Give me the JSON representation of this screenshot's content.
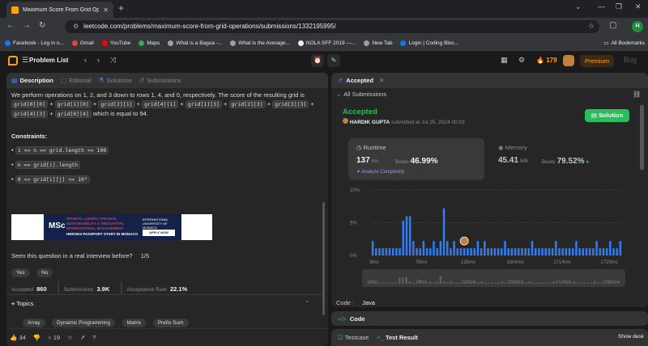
{
  "browser": {
    "tab_title": "Maximum Score From Grid Ope",
    "url": "leetcode.com/problems/maximum-score-from-grid-operations/submissions/1332195995/",
    "bookmarks": [
      {
        "label": "Facebook - Log in o...",
        "color": "#1877f2"
      },
      {
        "label": "Gmail",
        "color": "#ea4335"
      },
      {
        "label": "YouTube",
        "color": "#ff0000"
      },
      {
        "label": "Maps",
        "color": "#34a853"
      },
      {
        "label": "What is a Bagua -...",
        "color": "#9aa0a6"
      },
      {
        "label": "What is the Average...",
        "color": "#9aa0a6"
      },
      {
        "label": "NOLA SFF 2019 —...",
        "color": "#eeeeee"
      },
      {
        "label": "New Tab",
        "color": "#9aa0a6"
      },
      {
        "label": "Login | Coding Bloc...",
        "color": "#1a73e8"
      }
    ],
    "all_bookmarks": "All Bookmarks",
    "profile_initial": "H"
  },
  "lc_nav": {
    "problem_list": "Problem List",
    "streak": "179",
    "premium": "Premium",
    "sign_label": "Bug"
  },
  "left": {
    "tabs": [
      {
        "label": "Description",
        "active": true
      },
      {
        "label": "Editorial",
        "active": false
      },
      {
        "label": "Solutions",
        "active": false
      },
      {
        "label": "Submissions",
        "active": false
      }
    ],
    "para_intro": "We perform operations on 1, 2, and 3 down to rows 1, 4, and 0, respectively. The score of the resulting grid is",
    "score_terms": [
      "grid[0][0]",
      "+",
      "grid[1][0]",
      "+",
      "grid[2][1]",
      "+",
      "grid[4][1]",
      "+",
      "grid[1][3]",
      "+",
      "grid[2][3]",
      "+",
      "grid[3][3]",
      "+",
      "grid[4][3]",
      "+",
      "grid[0][4]"
    ],
    "score_tail": "which is equal to 94.",
    "constraints_title": "Constraints:",
    "constraints": [
      "1 <= n == grid.length <= 100",
      "n == grid[i].length",
      "0 <= grid[i][j] <= 10⁹"
    ],
    "ad": {
      "msc": "MSc",
      "line1": "SPORTS, LUXURY, FINANCE, SUSTAINABILITY & INNOVATION, INTERNATIONAL MANAGEMENT",
      "line2": "HEROES PASSPORT START IN MONACO",
      "apply": "APPLY NOW",
      "logo": "INTERNATIONAL UNIVERSITY OF MONACO"
    },
    "interview_q": "Seen this question in a real interview before?",
    "interview_count": "1/5",
    "yes": "Yes",
    "no": "No",
    "stats": [
      {
        "label": "Accepted",
        "value": "860"
      },
      {
        "label": "Submissions",
        "value": "3.9K"
      },
      {
        "label": "Acceptance Rate",
        "value": "22.1%"
      }
    ],
    "topics_title": "Topics",
    "topics": [
      "Array",
      "Dynamic Programming",
      "Matrix",
      "Prefix Sum"
    ],
    "footer": {
      "likes": "34",
      "comments": "19"
    }
  },
  "right": {
    "tab_label": "Accepted",
    "all_submissions": "All Submissions",
    "status": "Accepted",
    "user": "HARDIK GUPTA",
    "submitted": "submitted at Jul 25, 2024 00:03",
    "solution_btn": "Solution",
    "runtime": {
      "title": "Runtime",
      "value": "137",
      "unit": "ms",
      "beats_label": "Beats",
      "beats": "46.99%",
      "analyze": "Analyze Complexity"
    },
    "memory": {
      "title": "Memory",
      "value": "45.41",
      "unit": "MB",
      "beats_label": "Beats",
      "beats": "79.52%"
    },
    "code_label": "Code",
    "lang": "Java"
  },
  "chart_data": {
    "type": "bar",
    "ylabel": "",
    "yticks": [
      "10%",
      "5%",
      "0%"
    ],
    "ylim": [
      0,
      10
    ],
    "xticks": [
      "9ms",
      "78ms",
      "135ms",
      "1604ms",
      "1714ms",
      "1729ms"
    ],
    "values": [
      2.2,
      1.1,
      1.1,
      1.1,
      1.1,
      1.1,
      1.1,
      1.1,
      1.1,
      5.3,
      6.0,
      6.0,
      2.2,
      1.1,
      1.1,
      2.2,
      1.1,
      1.1,
      2.2,
      1.1,
      2.2,
      7.2,
      2.2,
      1.1,
      2.2,
      1.1,
      1.1,
      1.1,
      1.1,
      1.1,
      1.1,
      2.2,
      1.1,
      2.2,
      1.1,
      1.1,
      1.1,
      1.1,
      1.1,
      2.2,
      1.1,
      1.1,
      1.1,
      1.1,
      1.1,
      1.1,
      1.1,
      2.2,
      1.1,
      1.1,
      1.1,
      1.1,
      1.1,
      1.1,
      2.2,
      1.1,
      1.1,
      1.1,
      1.1,
      1.1,
      2.2,
      1.1,
      1.1,
      1.1,
      1.1,
      1.1,
      2.2,
      1.1,
      1.1,
      1.1,
      2.2,
      1.1,
      1.1,
      2.2
    ],
    "highlight_index": 27,
    "bar_color": "#2e7cf6",
    "grid": true
  },
  "code_panel": {
    "title": "Code"
  },
  "test_panel": {
    "testcase": "Testcase",
    "result": "Test Result"
  },
  "taskbar": {
    "show_desktop": "Show desk"
  }
}
